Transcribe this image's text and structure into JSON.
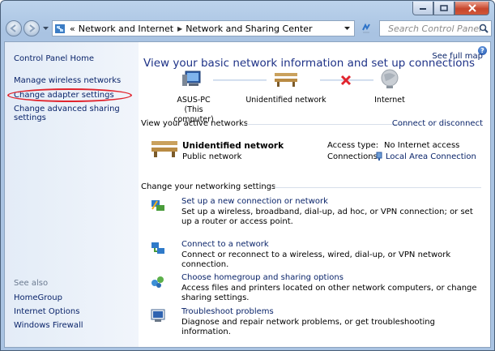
{
  "window": {
    "caption": {
      "minimize": "minimize-icon",
      "maximize": "maximize-icon",
      "close": "close-icon"
    }
  },
  "address_bar": {
    "overflow": "«",
    "crumbs": [
      "Network and Internet",
      "Network and Sharing Center"
    ],
    "search_placeholder": "Search Control Panel"
  },
  "left_pane": {
    "home": "Control Panel Home",
    "links": [
      "Manage wireless networks",
      "Change adapter settings",
      "Change advanced sharing settings"
    ],
    "see_also_label": "See also",
    "see_also": [
      "HomeGroup",
      "Internet Options",
      "Windows Firewall"
    ],
    "highlight_color": "#e1242d"
  },
  "main": {
    "title": "View your basic network information and set up connections",
    "see_full_map": "See full map",
    "map": {
      "computer_name": "ASUS-PC",
      "computer_sub": "(This computer)",
      "network": "Unidentified network",
      "internet": "Internet"
    },
    "active_header": "View your active networks",
    "connect_link": "Connect or disconnect",
    "active": {
      "name": "Unidentified network",
      "type": "Public network",
      "access_label": "Access type:",
      "access_value": "No Internet access",
      "connections_label": "Connections:",
      "connections_value": "Local Area Connection"
    },
    "change_header": "Change your networking settings",
    "tasks": [
      {
        "title": "Set up a new connection or network",
        "desc": "Set up a wireless, broadband, dial-up, ad hoc, or VPN connection; or set up a router or access point."
      },
      {
        "title": "Connect to a network",
        "desc": "Connect or reconnect to a wireless, wired, dial-up, or VPN network connection."
      },
      {
        "title": "Choose homegroup and sharing options",
        "desc": "Access files and printers located on other network computers, or change sharing settings."
      },
      {
        "title": "Troubleshoot problems",
        "desc": "Diagnose and repair network problems, or get troubleshooting information."
      }
    ]
  },
  "colors": {
    "link": "#0a246a",
    "title": "#1e3287",
    "error": "#e1242d"
  }
}
